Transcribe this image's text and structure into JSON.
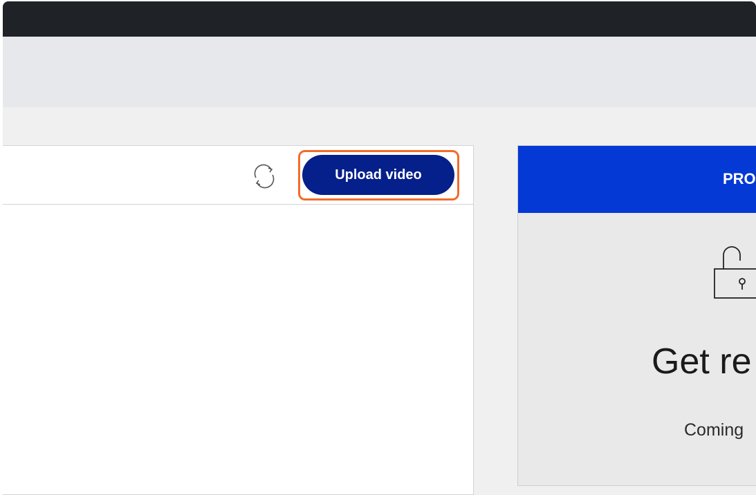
{
  "toolbar": {
    "upload_label": "Upload video",
    "refresh_icon": "refresh-icon"
  },
  "pro_card": {
    "header_label": "PRO",
    "icon": "lock-icon",
    "title": "Get re",
    "subtitle": "Coming"
  },
  "colors": {
    "top_bar": "#1f2328",
    "nav_band": "#e6e8eb",
    "page_bg": "#f0f0f0",
    "upload_button": "#05208a",
    "highlight": "#f26c2a",
    "pro_header": "#0539d6",
    "card_bg": "#e9e9e9"
  }
}
